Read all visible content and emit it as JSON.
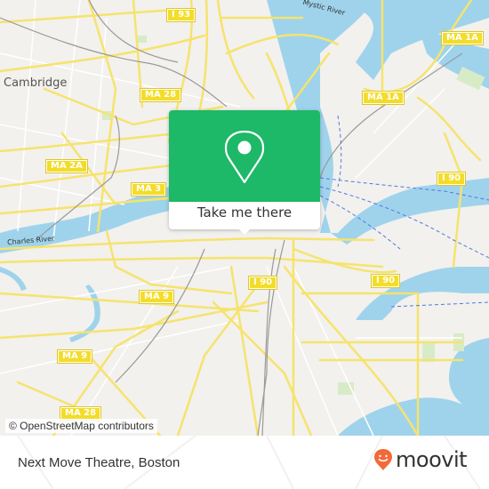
{
  "map": {
    "place_labels": [
      {
        "id": "cambridge",
        "text": "Cambridge"
      }
    ],
    "water_labels": [
      {
        "id": "mystic-river",
        "text": "Mystic River"
      },
      {
        "id": "charles-river",
        "text": "Charles River"
      }
    ],
    "road_shields": [
      {
        "id": "i93",
        "text": "I 93"
      },
      {
        "id": "ma28-top",
        "text": "MA 28"
      },
      {
        "id": "ma2a",
        "text": "MA 2A"
      },
      {
        "id": "ma3",
        "text": "MA 3"
      },
      {
        "id": "ma1a-right",
        "text": "MA 1A"
      },
      {
        "id": "ma1a-mid",
        "text": "MA 1A"
      },
      {
        "id": "i90-right",
        "text": "I 90"
      },
      {
        "id": "ma9-mid",
        "text": "MA 9"
      },
      {
        "id": "ma9-left",
        "text": "MA 9"
      },
      {
        "id": "i90-center",
        "text": "I 90"
      },
      {
        "id": "i90-harbor",
        "text": "I 90"
      },
      {
        "id": "ma28-bottom",
        "text": "MA 28"
      }
    ],
    "attribution": "© OpenStreetMap contributors",
    "colors": {
      "land": "#f2f1ed",
      "water": "#9fd3ec",
      "road": "#f6e36e",
      "park": "#d7ebc7"
    }
  },
  "popup": {
    "icon": "map-pin-icon",
    "button_label": "Take me there",
    "accent_color": "#1db868"
  },
  "footer": {
    "title": "Next Move Theatre, Boston",
    "brand": "moovit",
    "brand_icon": "moovit-logo-icon",
    "brand_color": "#f26a3a"
  }
}
